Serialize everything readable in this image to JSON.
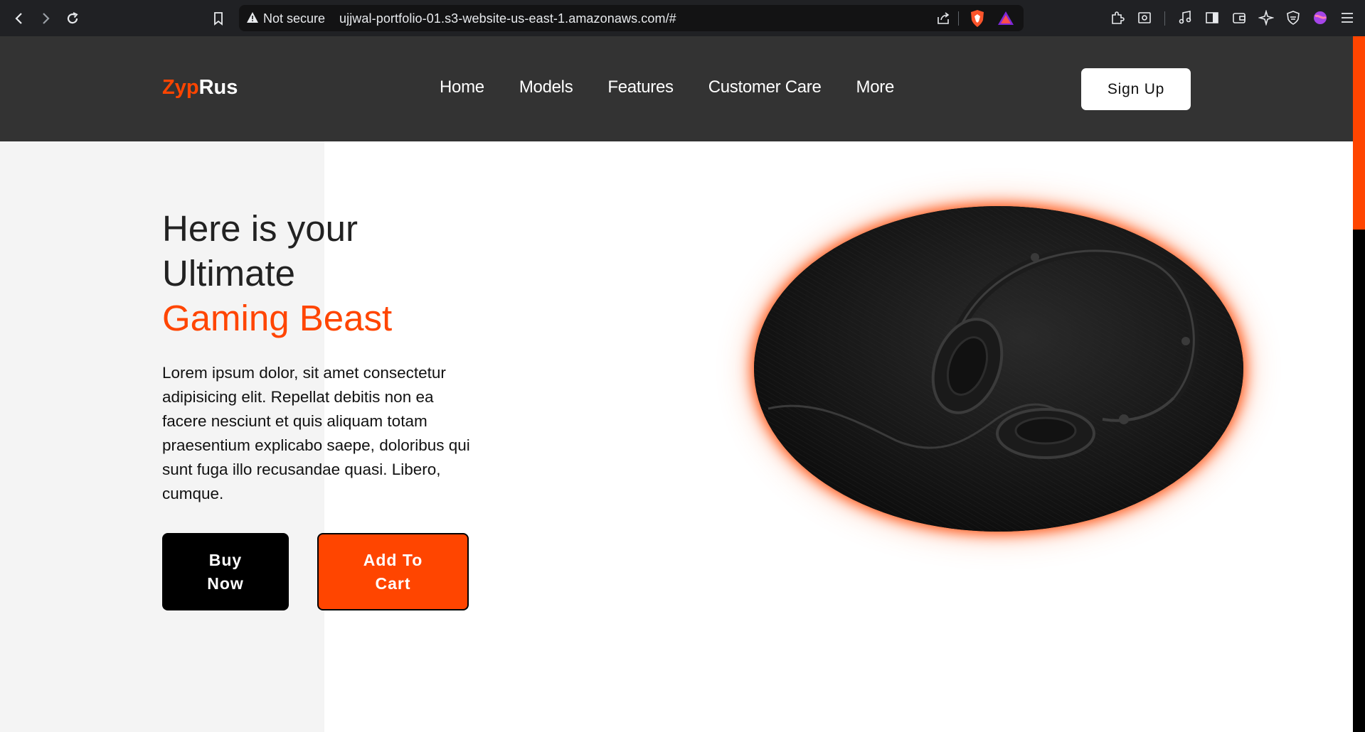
{
  "browser": {
    "security_label": "Not secure",
    "url": "ujjwal-portfolio-01.s3-website-us-east-1.amazonaws.com/#"
  },
  "header": {
    "logo_accent": "Zyp",
    "logo_rest": "Rus",
    "nav": [
      "Home",
      "Models",
      "Features",
      "Customer Care",
      "More"
    ],
    "signup_label": "Sign Up"
  },
  "hero": {
    "title_line1": "Here is your",
    "title_line2": "Ultimate",
    "title_accent": "Gaming Beast",
    "body": "Lorem ipsum dolor, sit amet consectetur adipisicing elit. Repellat debitis non ea facere nesciunt et quis aliquam totam praesentium explicabo saepe, doloribus qui sunt fuga illo recusandae quasi. Libero, cumque.",
    "buy_line1": "Buy",
    "buy_line2": "Now",
    "cart_line1": "Add To",
    "cart_line2": "Cart",
    "image_icon": "headphones-photo"
  },
  "colors": {
    "accent": "#ff4500",
    "header_bg": "#333333",
    "panel_bg": "#f4f4f4"
  }
}
